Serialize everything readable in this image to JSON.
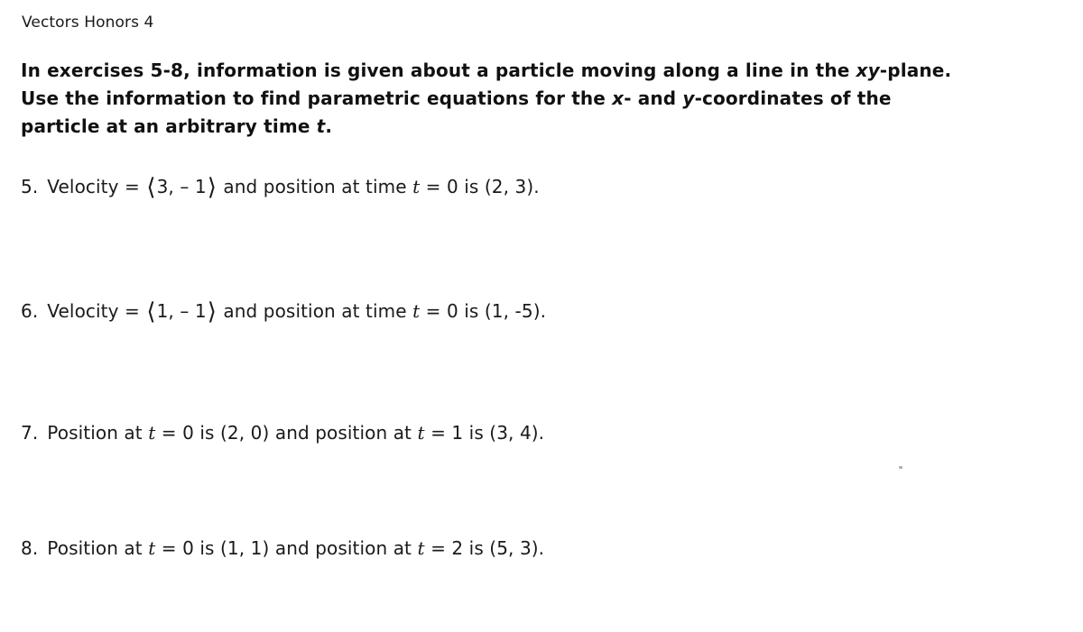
{
  "header": {
    "title": "Vectors Honors 4"
  },
  "instructions": {
    "line1_a": "In exercises 5-8, information is given about a particle moving along a line in the ",
    "line1_var": "xy",
    "line1_b": "-plane.",
    "line2_a": "Use the information to find parametric equations for the ",
    "line2_var_x": "x",
    "line2_b": "- and ",
    "line2_var_y": "y",
    "line2_c": "-coordinates of the",
    "line3_a": "particle at an arbitrary time ",
    "line3_var": "t",
    "line3_b": "."
  },
  "exercises": [
    {
      "number": "5.",
      "prefix": "Velocity = ",
      "open_angle": "⟨",
      "vector": "3, – 1",
      "close_angle": "⟩",
      "middle": " and position at time ",
      "t": "t",
      "suffix": " = 0 is (2, 3)."
    },
    {
      "number": "6.",
      "prefix": "Velocity = ",
      "open_angle": "⟨",
      "vector": "1, – 1",
      "close_angle": "⟩",
      "middle": " and position at time ",
      "t": "t",
      "suffix": " = 0 is (1, -5)."
    },
    {
      "number": "7.",
      "part1": "Position at ",
      "t1": "t",
      "part2": " = 0 is (2, 0) and position at ",
      "t2": "t",
      "part3": " = 1 is (3, 4)."
    },
    {
      "number": "8.",
      "part1": "Position at ",
      "t1": "t",
      "part2": " = 0 is (1, 1) and position at ",
      "t2": "t",
      "part3": " = 2 is (5, 3)."
    }
  ]
}
